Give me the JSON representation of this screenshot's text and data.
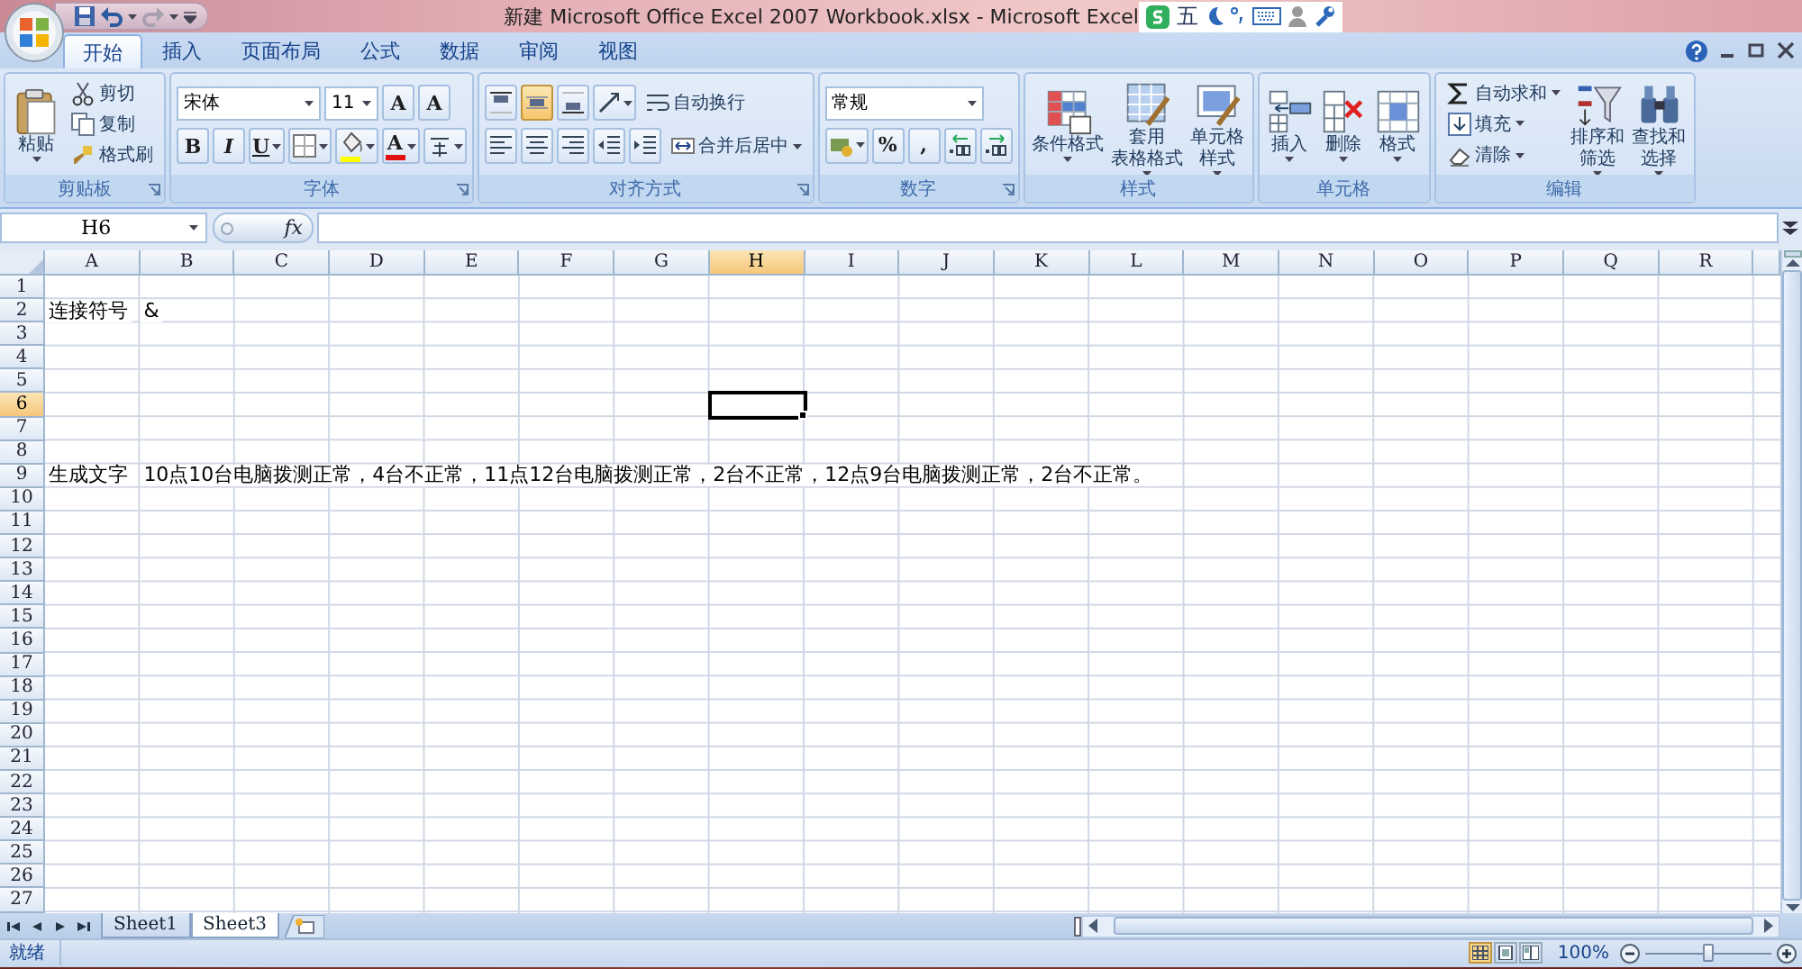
{
  "title_bar": {
    "title": "新建 Microsoft Office Excel 2007 Workbook.xlsx - Microsoft Excel",
    "ime_label": "五"
  },
  "tabs": [
    {
      "label": "开始",
      "selected": true
    },
    {
      "label": "插入",
      "selected": false
    },
    {
      "label": "页面布局",
      "selected": false
    },
    {
      "label": "公式",
      "selected": false
    },
    {
      "label": "数据",
      "selected": false
    },
    {
      "label": "审阅",
      "selected": false
    },
    {
      "label": "视图",
      "selected": false
    }
  ],
  "ribbon": [
    {
      "name": "剪贴板",
      "launcher": true,
      "kind": "columns",
      "parts": [
        [
          {
            "kind": "large",
            "lines": [
              "粘贴"
            ],
            "dropdown": true
          }
        ],
        [
          {
            "kind": "small",
            "label": "剪切",
            "dropdown": false
          },
          {
            "kind": "small",
            "label": "复制",
            "dropdown": false
          },
          {
            "kind": "small",
            "label": "格式刷",
            "dropdown": false
          }
        ]
      ]
    },
    {
      "name": "字体",
      "launcher": true,
      "kind": "rows",
      "parts": [
        [
          {
            "kind": "combo",
            "value": "宋体"
          },
          {
            "kind": "combo",
            "value": "11"
          },
          {
            "kind": "char",
            "label": "A",
            "dropdown": false
          },
          {
            "kind": "char",
            "label": "A",
            "dropdown": false
          }
        ],
        [
          {
            "kind": "bold",
            "label": "B",
            "dropdown": false
          },
          {
            "kind": "italic",
            "label": "I",
            "dropdown": false
          },
          {
            "kind": "underline",
            "label": "U",
            "dropdown": true
          },
          {
            "kind": "iconbtn",
            "dropdown": true
          },
          {
            "kind": "iconbtn",
            "dropdown": true,
            "color": "#ffff00"
          },
          {
            "kind": "char",
            "label": "A",
            "dropdown": true,
            "color": "#e01010"
          },
          {
            "kind": "iconbtn",
            "dropdown": true
          }
        ]
      ]
    },
    {
      "name": "对齐方式",
      "launcher": true,
      "kind": "rows",
      "parts": [
        [
          {
            "kind": "iconbtn",
            "selected": false
          },
          {
            "kind": "iconbtn",
            "selected": true
          },
          {
            "kind": "iconbtn",
            "selected": false
          },
          {
            "kind": "iconbtn",
            "selected": false,
            "dropdown": true
          },
          {
            "kind": "small",
            "label": "自动换行",
            "dropdown": false
          }
        ],
        [
          {
            "kind": "iconbtn",
            "selected": false
          },
          {
            "kind": "iconbtn",
            "selected": false
          },
          {
            "kind": "iconbtn",
            "selected": false
          },
          {
            "kind": "iconbtn",
            "selected": false
          },
          {
            "kind": "iconbtn",
            "selected": false
          },
          {
            "kind": "small",
            "label": "合并后居中",
            "dropdown": true
          }
        ]
      ]
    },
    {
      "name": "数字",
      "launcher": true,
      "kind": "rows",
      "parts": [
        [
          {
            "kind": "combo",
            "value": "常规"
          }
        ],
        [
          {
            "kind": "iconbtn",
            "dropdown": true
          },
          {
            "kind": "char",
            "label": "%",
            "dropdown": false
          },
          {
            "kind": "char",
            "label": ",",
            "dropdown": false
          },
          {
            "kind": "iconbtn",
            "dropdown": false
          },
          {
            "kind": "iconbtn",
            "dropdown": false
          }
        ]
      ]
    },
    {
      "name": "样式",
      "launcher": false,
      "kind": "columns",
      "parts": [
        [
          {
            "kind": "large",
            "lines": [
              "条件格式"
            ],
            "dropdown": true
          }
        ],
        [
          {
            "kind": "large",
            "lines": [
              "套用",
              "表格格式"
            ],
            "dropdown": true
          }
        ],
        [
          {
            "kind": "large",
            "lines": [
              "单元格",
              "样式"
            ],
            "dropdown": true
          }
        ]
      ]
    },
    {
      "name": "单元格",
      "launcher": false,
      "kind": "columns",
      "parts": [
        [
          {
            "kind": "large",
            "lines": [
              "插入"
            ],
            "dropdown": true
          }
        ],
        [
          {
            "kind": "large",
            "lines": [
              "删除"
            ],
            "dropdown": true
          }
        ],
        [
          {
            "kind": "large",
            "lines": [
              "格式"
            ],
            "dropdown": true
          }
        ]
      ]
    },
    {
      "name": "编辑",
      "launcher": false,
      "kind": "columns",
      "parts": [
        [
          {
            "kind": "small",
            "label": "自动求和",
            "dropdown": true
          },
          {
            "kind": "small",
            "label": "填充",
            "dropdown": true
          },
          {
            "kind": "small",
            "label": "清除",
            "dropdown": true
          }
        ],
        [
          {
            "kind": "large",
            "lines": [
              "排序和",
              "筛选"
            ],
            "dropdown": true
          }
        ],
        [
          {
            "kind": "large",
            "lines": [
              "查找和",
              "选择"
            ],
            "dropdown": true
          }
        ]
      ]
    }
  ],
  "formula_bar": {
    "name_box": "H6",
    "fx": "fx"
  },
  "columns": [
    {
      "label": "A",
      "selected": false
    },
    {
      "label": "B",
      "selected": false
    },
    {
      "label": "C",
      "selected": false
    },
    {
      "label": "D",
      "selected": false
    },
    {
      "label": "E",
      "selected": false
    },
    {
      "label": "F",
      "selected": false
    },
    {
      "label": "G",
      "selected": false
    },
    {
      "label": "H",
      "selected": true
    },
    {
      "label": "I",
      "selected": false
    },
    {
      "label": "J",
      "selected": false
    },
    {
      "label": "K",
      "selected": false
    },
    {
      "label": "L",
      "selected": false
    },
    {
      "label": "M",
      "selected": false
    },
    {
      "label": "N",
      "selected": false
    },
    {
      "label": "O",
      "selected": false
    },
    {
      "label": "P",
      "selected": false
    },
    {
      "label": "Q",
      "selected": false
    },
    {
      "label": "R",
      "selected": false
    }
  ],
  "rows": [
    {
      "label": "1",
      "selected": false
    },
    {
      "label": "2",
      "selected": false,
      "cells": [
        "连接符号",
        "&"
      ]
    },
    {
      "label": "3",
      "selected": false
    },
    {
      "label": "4",
      "selected": false
    },
    {
      "label": "5",
      "selected": false
    },
    {
      "label": "6",
      "selected": true
    },
    {
      "label": "7",
      "selected": false
    },
    {
      "label": "8",
      "selected": false
    },
    {
      "label": "9",
      "selected": false,
      "cells": [
        "生成文字",
        "10点10台电脑拨测正常，4台不正常，11点12台电脑拨测正常，2台不正常，12点9台电脑拨测正常，2台不正常。"
      ]
    },
    {
      "label": "10",
      "selected": false
    },
    {
      "label": "11",
      "selected": false
    },
    {
      "label": "12",
      "selected": false
    },
    {
      "label": "13",
      "selected": false
    },
    {
      "label": "14",
      "selected": false
    },
    {
      "label": "15",
      "selected": false
    },
    {
      "label": "16",
      "selected": false
    },
    {
      "label": "17",
      "selected": false
    },
    {
      "label": "18",
      "selected": false
    },
    {
      "label": "19",
      "selected": false
    },
    {
      "label": "20",
      "selected": false
    },
    {
      "label": "21",
      "selected": false
    },
    {
      "label": "22",
      "selected": false
    },
    {
      "label": "23",
      "selected": false
    },
    {
      "label": "24",
      "selected": false
    },
    {
      "label": "25",
      "selected": false
    },
    {
      "label": "26",
      "selected": false
    },
    {
      "label": "27",
      "selected": false
    }
  ],
  "sheets": [
    {
      "label": "Sheet1",
      "selected": false
    },
    {
      "label": "Sheet3",
      "selected": true
    }
  ],
  "status_bar": {
    "status": "就绪",
    "views": [
      {
        "kind": "normal",
        "selected": true
      },
      {
        "kind": "page_layout",
        "selected": false
      },
      {
        "kind": "page_break",
        "selected": false
      }
    ],
    "zoom": "100%",
    "zoom_slider": {
      "level": 0.5
    }
  }
}
